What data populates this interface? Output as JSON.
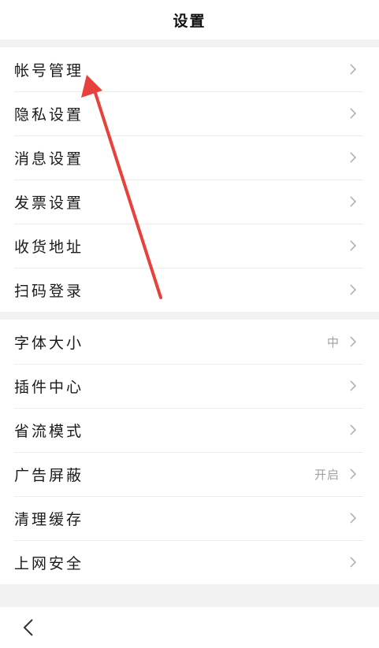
{
  "header": {
    "title": "设置"
  },
  "groups": [
    {
      "items": [
        {
          "label": "帐号管理",
          "value": ""
        },
        {
          "label": "隐私设置",
          "value": ""
        },
        {
          "label": "消息设置",
          "value": ""
        },
        {
          "label": "发票设置",
          "value": ""
        },
        {
          "label": "收货地址",
          "value": ""
        },
        {
          "label": "扫码登录",
          "value": ""
        }
      ]
    },
    {
      "items": [
        {
          "label": "字体大小",
          "value": "中"
        },
        {
          "label": "插件中心",
          "value": ""
        },
        {
          "label": "省流模式",
          "value": ""
        },
        {
          "label": "广告屏蔽",
          "value": "开启"
        },
        {
          "label": "清理缓存",
          "value": ""
        },
        {
          "label": "上网安全",
          "value": ""
        }
      ]
    }
  ],
  "icons": {
    "row_chevron": "chevron-right-icon",
    "back": "chevron-left-icon",
    "annotation": "red-arrow-annotation"
  },
  "colors": {
    "annotation_arrow": "#e8403a",
    "chevron": "#b3b3b3",
    "section_gap": "#f2f2f2"
  }
}
